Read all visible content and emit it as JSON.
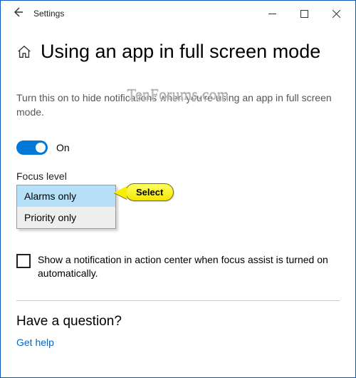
{
  "window": {
    "app_title": "Settings"
  },
  "icons": {
    "back": "back-arrow-icon",
    "home": "home-icon",
    "min": "minimize-icon",
    "max": "maximize-icon",
    "close": "close-icon"
  },
  "header": {
    "title": "Using an app in full screen mode"
  },
  "watermark": "TenForums.com",
  "description": "Turn this on to hide notifications when you're using an app in full screen mode.",
  "toggle": {
    "state": "On"
  },
  "focus": {
    "label": "Focus level",
    "options": [
      "Alarms only",
      "Priority only"
    ],
    "selected": "Alarms only"
  },
  "annotation": {
    "label": "Select"
  },
  "checkbox": {
    "label": "Show a notification in action center when focus assist is turned on automatically.",
    "checked": false
  },
  "help": {
    "heading": "Have a question?",
    "link": "Get help"
  }
}
